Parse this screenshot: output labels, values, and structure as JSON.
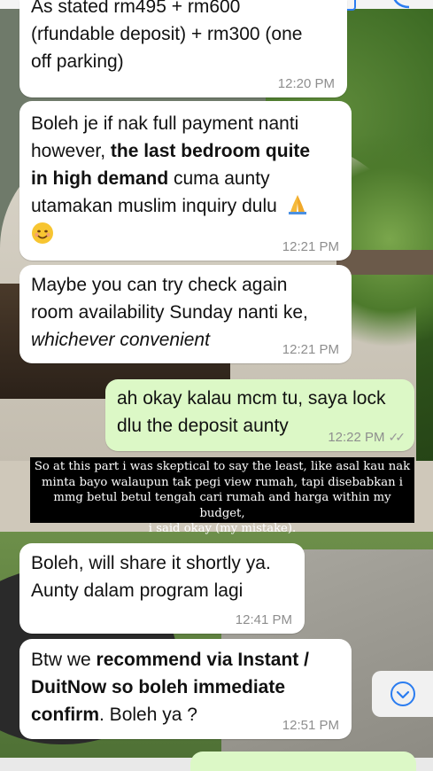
{
  "colors": {
    "incoming_bubble": "#ffffff",
    "outgoing_bubble": "#dcf8c6",
    "timestamp": "#8e8e8e",
    "accent": "#2a7cf0",
    "caption_bg": "#000000"
  },
  "messages": [
    {
      "direction": "in",
      "lines": [
        "As stated rm495 + rm600",
        "(rfundable deposit) + rm300 (one",
        "off parking)"
      ],
      "time": "12:20 PM"
    },
    {
      "direction": "in",
      "l1": "Boleh je if nak full payment nanti",
      "l2a": "however, ",
      "l2b": "the last bedroom quite",
      "l3a": "in high demand",
      "l3b": " cuma aunty",
      "l4": "utamakan muslim inquiry dulu",
      "emoji_pray": "folded-hands-emoji",
      "emoji_smile": "smiling-face-emoji",
      "time": "12:21 PM"
    },
    {
      "direction": "in",
      "l1": "Maybe you can try check again",
      "l2": "room availability Sunday nanti ke,",
      "l3": "whichever convenient",
      "time": "12:21 PM"
    },
    {
      "direction": "out",
      "l1": "ah okay kalau mcm tu, saya lock",
      "l2": "dlu the deposit aunty",
      "time": "12:22 PM",
      "status_icon": "double-check-icon"
    },
    {
      "direction": "in",
      "l1": "Boleh, will share it shortly ya.",
      "l2": "Aunty dalam program lagi",
      "time": "12:41 PM"
    },
    {
      "direction": "in",
      "l1a": "Btw we ",
      "l1b": "recommend via Instant /",
      "l2": "DuitNow so boleh immediate",
      "l3a": "confirm",
      "l3b": ".  Boleh ya ?",
      "time": "12:51 PM"
    }
  ],
  "caption": {
    "lines": [
      "So at this part i was skeptical to say the least, like asal kau nak",
      "minta bayo walaupun tak pegi view rumah, tapi disebabkan i",
      "mmg betul betul tengah cari rumah and harga within my budget,",
      "i said okay (my mistake)."
    ]
  },
  "scroll_button": {
    "icon": "chevron-down-icon"
  }
}
